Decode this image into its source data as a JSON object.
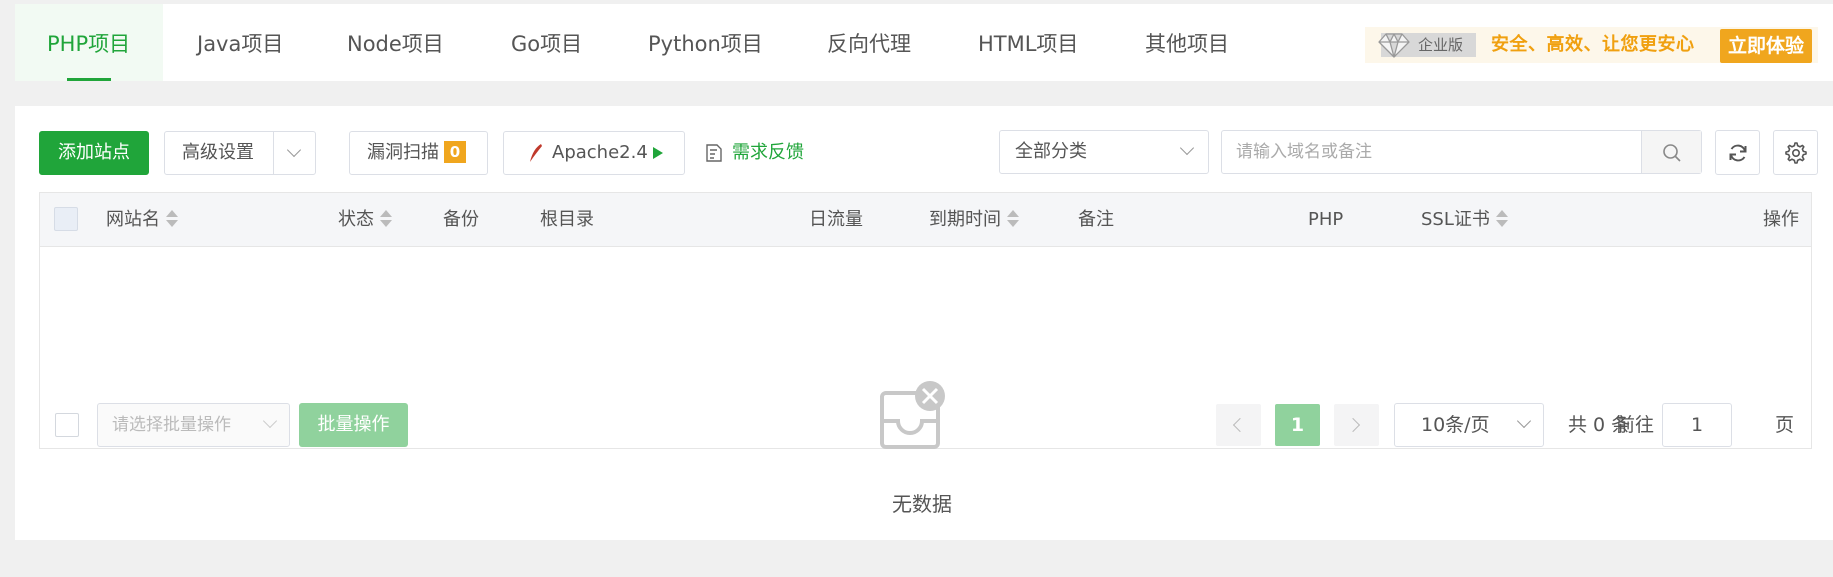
{
  "tabs": [
    {
      "label": "PHP项目",
      "active": true
    },
    {
      "label": "Java项目"
    },
    {
      "label": "Node项目"
    },
    {
      "label": "Go项目"
    },
    {
      "label": "Python项目"
    },
    {
      "label": "反向代理"
    },
    {
      "label": "HTML项目"
    },
    {
      "label": "其他项目"
    }
  ],
  "promo": {
    "badge": "企业版",
    "slogan": "安全、高效、让您更安心",
    "cta": "立即体验"
  },
  "toolbar": {
    "add_site": "添加站点",
    "advanced": "高级设置",
    "vuln_scan": "漏洞扫描",
    "vuln_count": "0",
    "server": "Apache2.4",
    "feedback": "需求反馈",
    "category": "全部分类",
    "search_placeholder": "请输入域名或备注"
  },
  "table": {
    "columns": [
      "网站名",
      "状态",
      "备份",
      "根目录",
      "日流量",
      "到期时间",
      "备注",
      "PHP",
      "SSL证书",
      "操作"
    ],
    "rows": [],
    "empty_text": "无数据"
  },
  "footer": {
    "batch_placeholder": "请选择批量操作",
    "batch_button": "批量操作",
    "current_page": "1",
    "page_size": "10条/页",
    "total": "共 0 条",
    "goto_label": "前往",
    "goto_value": "1",
    "page_unit": "页"
  },
  "colors": {
    "accent": "#20a53a",
    "warning": "#f0a61e"
  }
}
